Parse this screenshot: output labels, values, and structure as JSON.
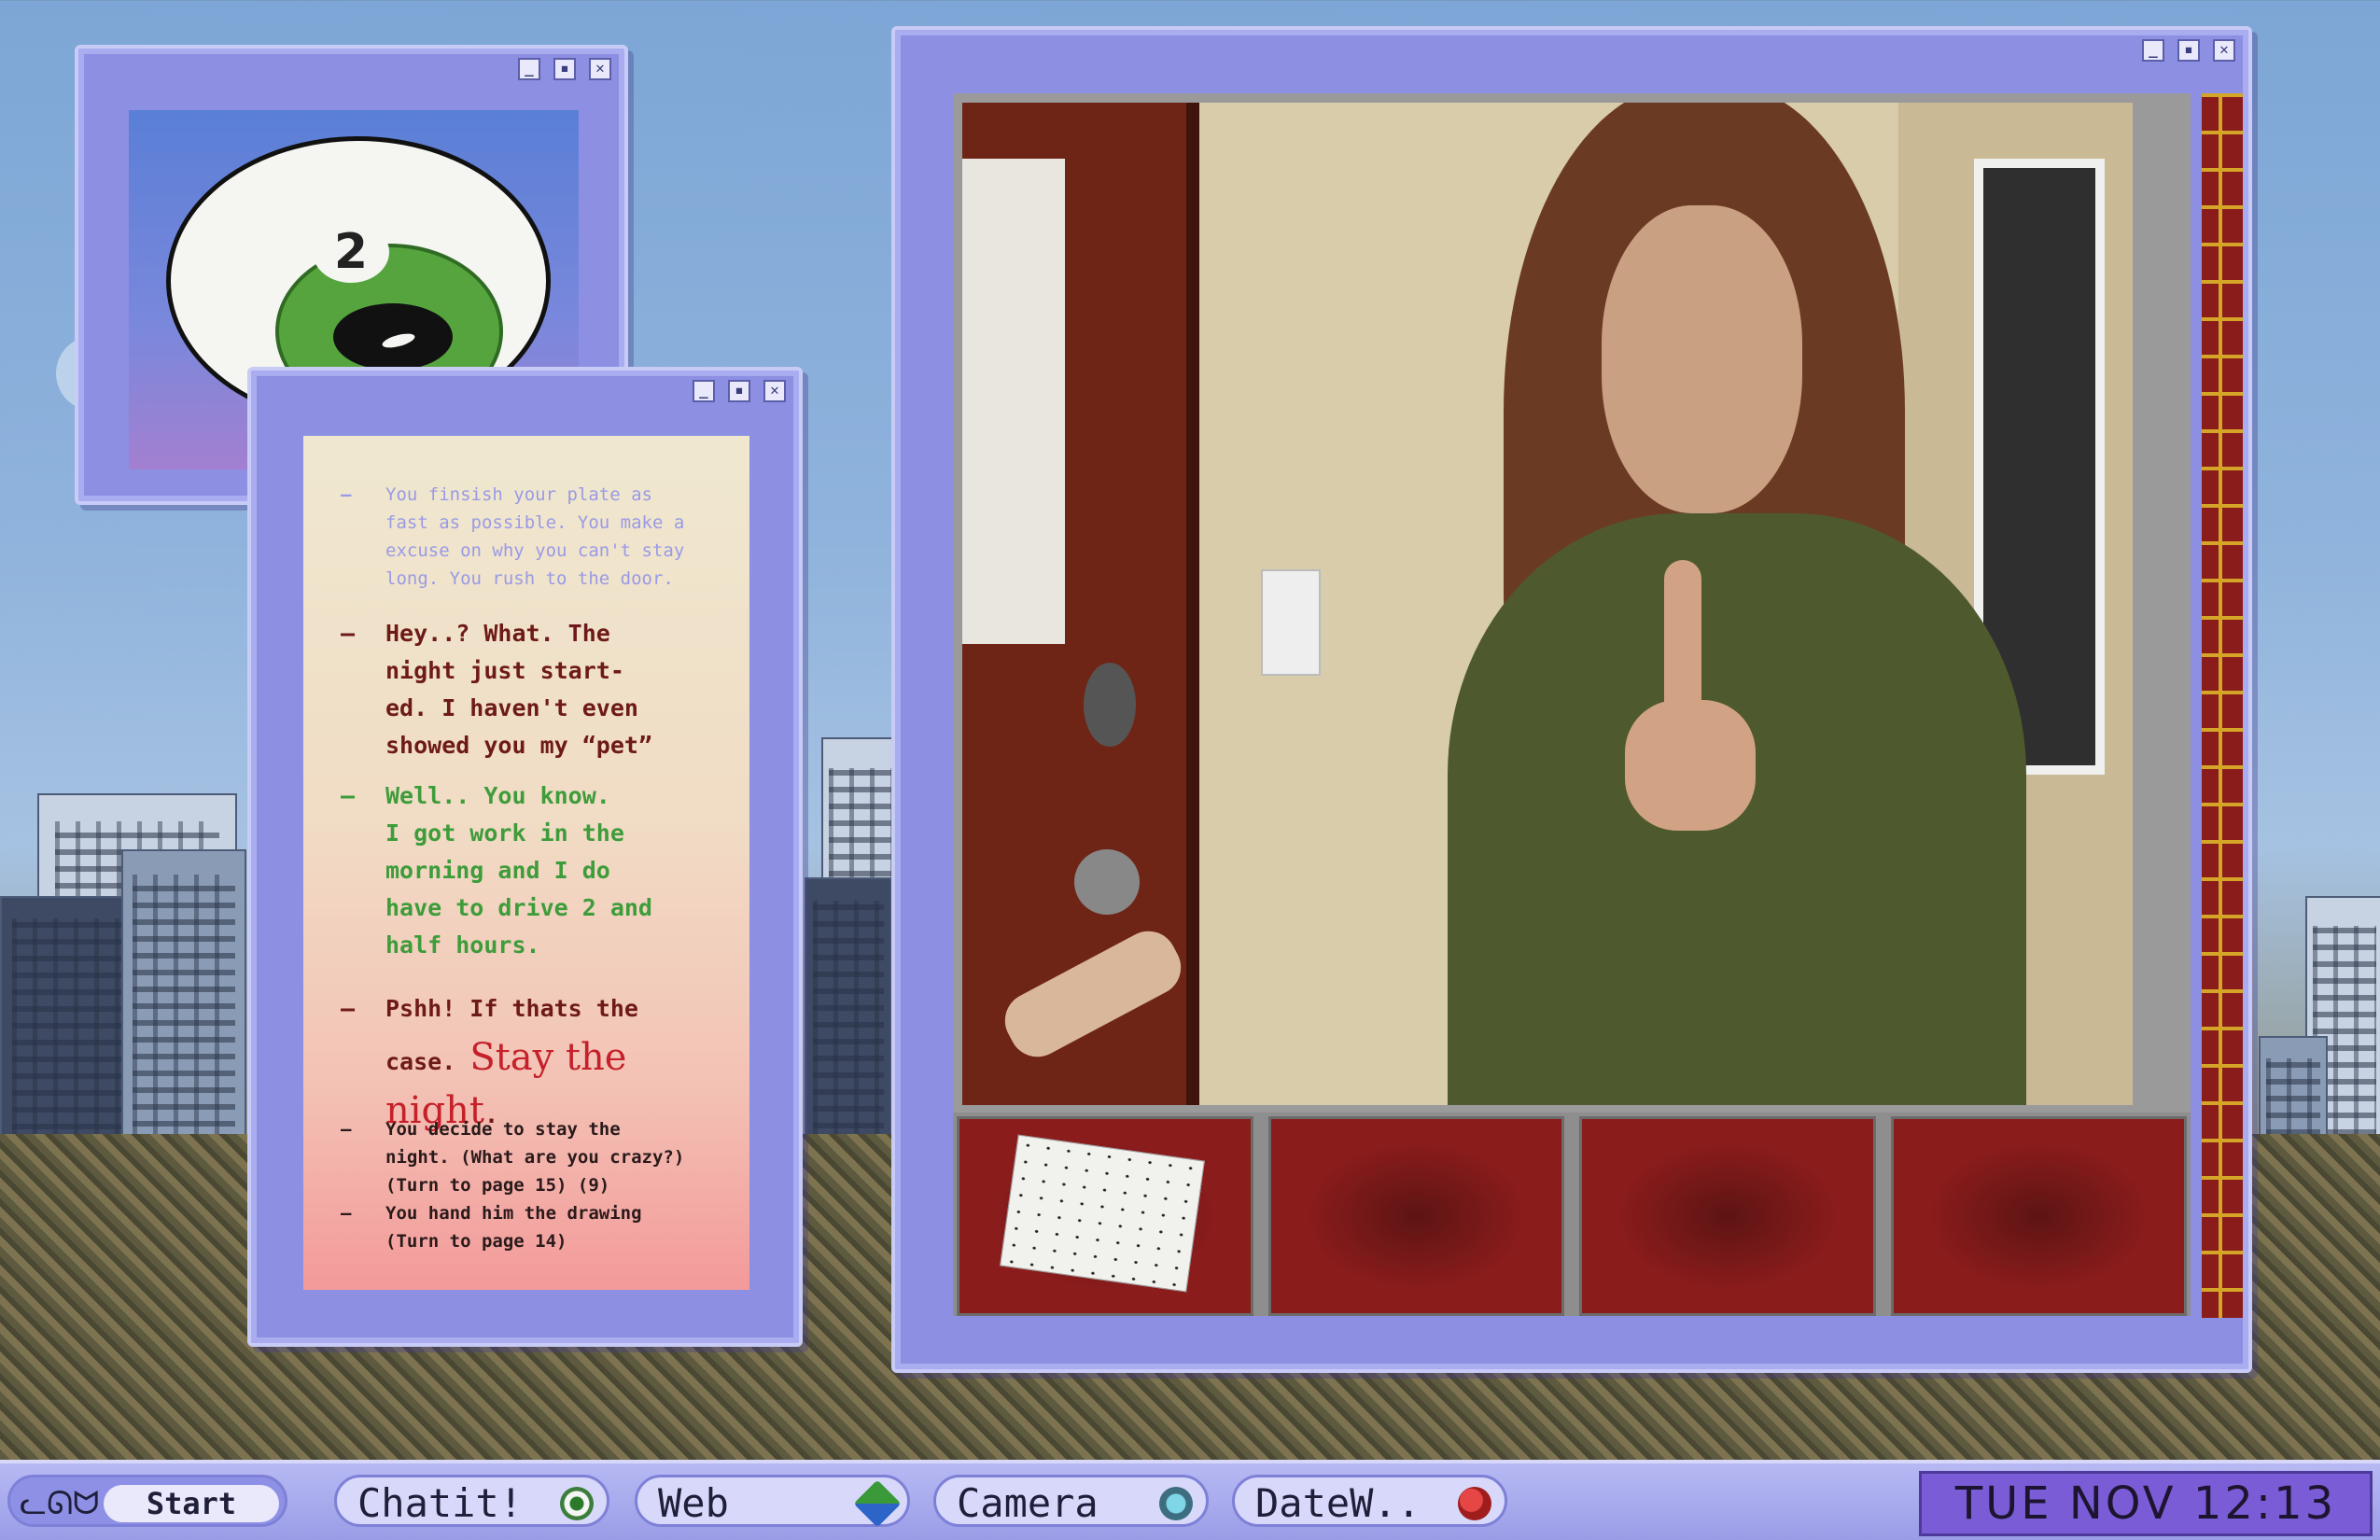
{
  "eye_window": {
    "badge_number": "2",
    "controls": [
      "_",
      "▪",
      "✕"
    ]
  },
  "story_window": {
    "controls": [
      "_",
      "▪",
      "✕"
    ],
    "entries": [
      {
        "dash": "—",
        "text": "You finsish your plate as\nfast as possible. You make a\nexcuse on why you can't stay\nlong. You rush to the door."
      },
      {
        "dash": "—",
        "text": "Hey..? What. The\nnight just start-\ned. I haven't even\nshowed you my “pet”"
      },
      {
        "dash": "—",
        "text": "Well.. You know.\nI got work in the\nmorning and I do\nhave to drive 2 and\nhalf hours."
      },
      {
        "dash": "—",
        "text_a": "Pshh! If thats the\ncase. ",
        "text_big": "Stay the night",
        "text_end": "."
      },
      {
        "dash": "—",
        "text": "You decide to stay the\nnight. (What are you crazy?)\n(Turn to page 15) (9)"
      },
      {
        "dash": "—",
        "text": "You hand him the drawing\n(Turn to page 14)"
      }
    ]
  },
  "photo_window": {
    "controls": [
      "_",
      "▪",
      "✕"
    ],
    "inventory": [
      {
        "item": "drawing"
      },
      {
        "item": "empty"
      },
      {
        "item": "empty"
      },
      {
        "item": "empty"
      }
    ]
  },
  "taskbar": {
    "start_label": "Start",
    "start_icon": "cat-icon",
    "buttons": [
      {
        "label": "Chatit!",
        "icon": "eye-icon"
      },
      {
        "label": "Web",
        "icon": "globe-icon"
      },
      {
        "label": "Camera",
        "icon": "lens-icon"
      },
      {
        "label": "DateW..",
        "icon": "heart-icon"
      }
    ],
    "clock": "TUE NOV 12:13"
  },
  "colors": {
    "window_frame": "#8c8fe2",
    "story_gray_text": "#9a9ae6",
    "story_red_text": "#6e1a1a",
    "story_green_text": "#3e9c3a",
    "accent_red": "#c6202a",
    "clock_bg": "#7a5cd6"
  }
}
